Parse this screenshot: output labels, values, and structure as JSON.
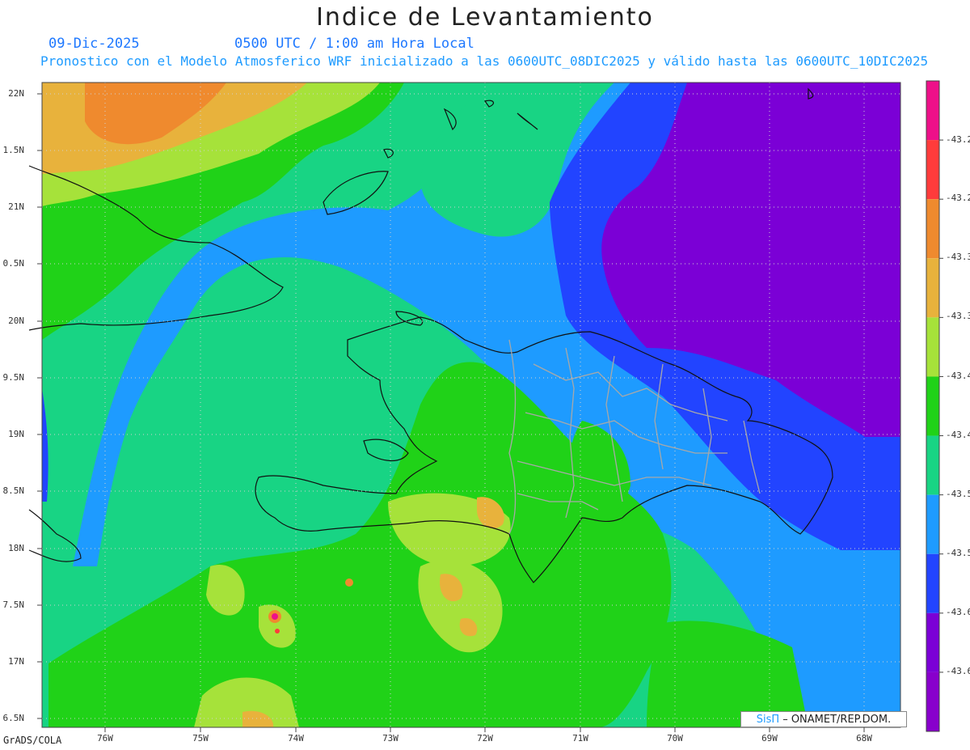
{
  "header": {
    "title": "Indice de Levantamiento",
    "date": "09-Dic-2025",
    "time": "0500 UTC / 1:00 am Hora Local",
    "subtitle": "Pronostico con el Modelo Atmosferico WRF inicializado a las 0600UTC_08DIC2025 y válido hasta las  0600UTC_10DIC2025"
  },
  "map": {
    "lat_labels": [
      "22N",
      "1.5N",
      "21N",
      "0.5N",
      "20N",
      "9.5N",
      "19N",
      "8.5N",
      "18N",
      "7.5N",
      "17N",
      "6.5N"
    ],
    "lon_labels": [
      "76W",
      "75W",
      "74W",
      "73W",
      "72W",
      "71W",
      "70W",
      "69W",
      "68W"
    ],
    "extent": {
      "lon_min": -76.65,
      "lon_max": -67.6,
      "lat_min": 16.4,
      "lat_max": 22.1
    },
    "colors": {
      "orange": "#ef8a2e",
      "lightorange": "#e8b23c",
      "lightgreen": "#a6e23a",
      "green": "#20d218",
      "seagreen": "#18d484",
      "lightblue": "#1e9bff",
      "blue": "#2244ff",
      "purple": "#7b00d6",
      "magenta": "#ee1089",
      "red": "#ff3b3b"
    }
  },
  "colorbar": {
    "colors": [
      "#ee1089",
      "#ff3b3b",
      "#ef8a2e",
      "#e8b23c",
      "#a6e23a",
      "#20d218",
      "#18d484",
      "#1e9bff",
      "#2244ff",
      "#7b00d6",
      "#8800cc"
    ],
    "labels": [
      "-43.2",
      "-43.2",
      "-43.3",
      "-43.3",
      "-43.4",
      "-43.4",
      "-43.5",
      "-43.5",
      "-43.6",
      "-43.6"
    ]
  },
  "footer": {
    "grads": "GrADS/COLA",
    "credit_logo": "SisΠ",
    "credit_text": "– ONAMET/REP.DOM."
  }
}
